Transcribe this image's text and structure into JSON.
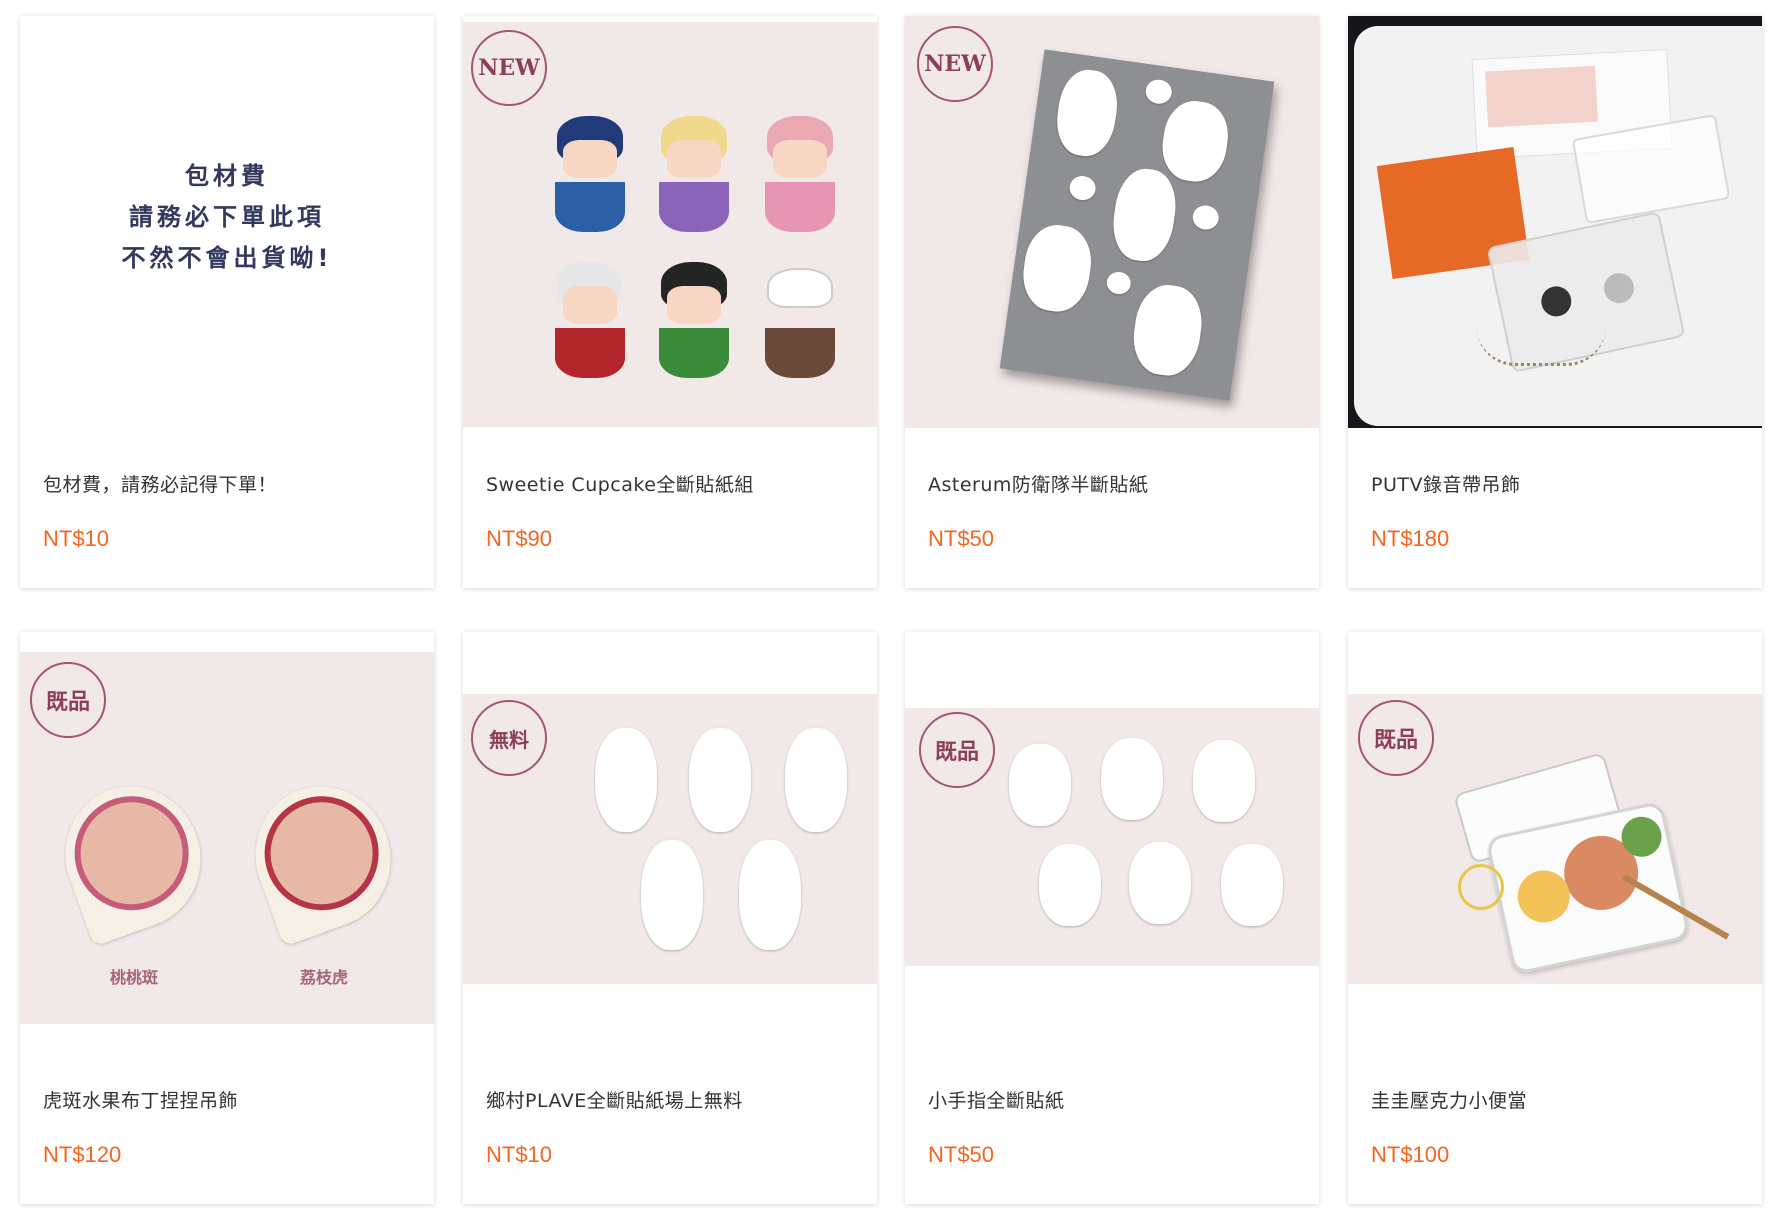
{
  "products": [
    {
      "name": "包材費，請務必記得下單！",
      "price": "NT$10",
      "image_text": [
        "包材費",
        "請務必下單此項",
        "不然不會出貨呦!"
      ]
    },
    {
      "name": "Sweetie Cupcake全斷貼紙組",
      "price": "NT$90",
      "badge": "NEW"
    },
    {
      "name": "Asterum防衛隊半斷貼紙",
      "price": "NT$50",
      "badge": "NEW"
    },
    {
      "name": "PUTV錄音帶吊飾",
      "price": "NT$180"
    },
    {
      "name": "虎斑水果布丁捏捏吊飾",
      "price": "NT$120",
      "badge": "既品",
      "image_labels": [
        "桃桃斑",
        "荔枝虎"
      ]
    },
    {
      "name": "鄉村PLAVE全斷貼紙場上無料",
      "price": "NT$10",
      "badge": "無料"
    },
    {
      "name": "小手指全斷貼紙",
      "price": "NT$50",
      "badge": "既品"
    },
    {
      "name": "圭圭壓克力小便當",
      "price": "NT$100",
      "badge": "既品"
    }
  ],
  "colors": {
    "price": "#f5651e",
    "badge": "#8c3f58",
    "image_bg": "#f1e8e8",
    "package_text": "#33395e"
  }
}
